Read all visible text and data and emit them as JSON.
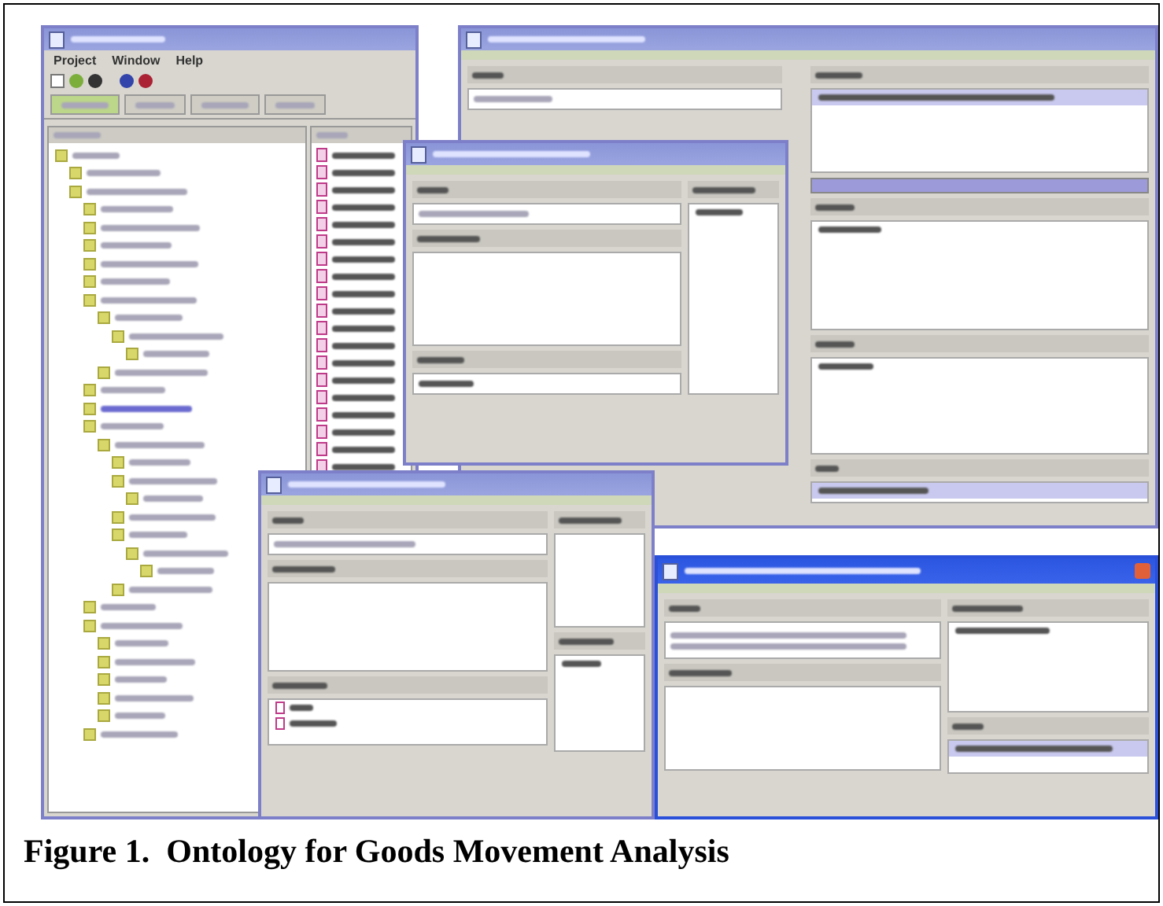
{
  "menu": [
    "Project",
    "Window",
    "Help"
  ],
  "tabs": [
    {
      "selected": true
    },
    {
      "selected": false
    },
    {
      "selected": false
    },
    {
      "selected": false
    }
  ],
  "caption": "Figure 1.  Ontology for Goods Movement Analysis"
}
